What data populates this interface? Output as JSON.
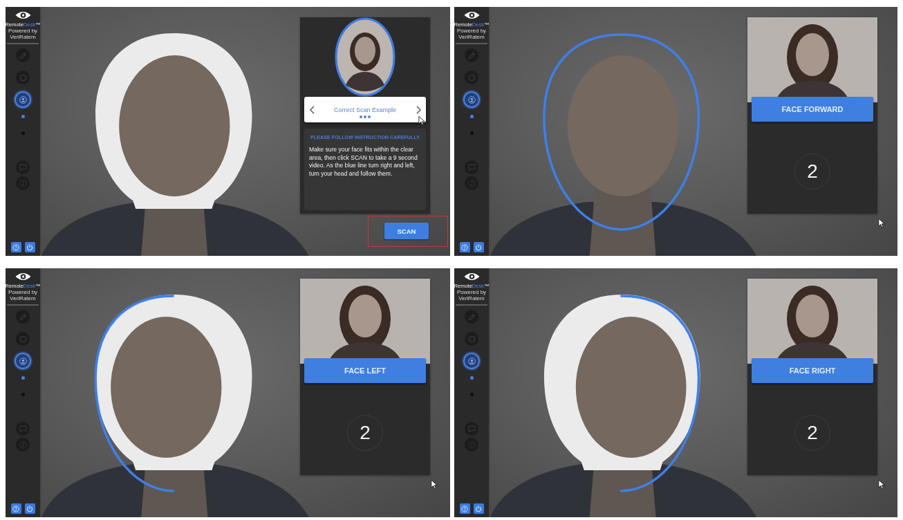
{
  "panels": [
    {
      "sidebar": {
        "logo": {
          "parts": [
            {
              "text": "Remote",
              "accent": false
            },
            {
              "text": "Desk",
              "accent": true
            },
            {
              "text": "™",
              "accent": false
            }
          ],
          "tagline": "Powered by VeriRatem"
        },
        "nav": [
          {
            "kind": "pencil",
            "selected": false
          },
          {
            "kind": "ring",
            "selected": false
          },
          {
            "kind": "user",
            "selected": true
          }
        ],
        "steps": [
          {
            "selected": true
          },
          {
            "selected": false
          }
        ],
        "tools": [
          {
            "kind": "chat"
          },
          {
            "kind": "info"
          }
        ],
        "footer_buttons": [
          {
            "kind": "help"
          },
          {
            "kind": "power"
          }
        ]
      },
      "camera": {
        "clear_area": true,
        "outline_left": false,
        "outline_right": false
      },
      "card": {
        "kind": "instructions",
        "carousel": {
          "title": "Correct Scan Example"
        },
        "heading": "PLEASE FOLLOW INSTRUCTION CAREFULLY",
        "text": "Make sure your face fits within the clear area, then click SCAN to take a 9 second video. As the blue line turn right and left, turn your head and follow them.",
        "button": {
          "label": "SCAN",
          "highlighted": true
        },
        "cursor": true
      }
    },
    {
      "sidebar": {
        "logo": {
          "parts": [
            {
              "text": "Remote",
              "accent": false
            },
            {
              "text": "Desk",
              "accent": true
            },
            {
              "text": "™",
              "accent": false
            }
          ],
          "tagline": "Powered by VeriRatem"
        },
        "nav": [
          {
            "kind": "pencil",
            "selected": false
          },
          {
            "kind": "ring",
            "selected": false
          },
          {
            "kind": "user",
            "selected": true
          }
        ],
        "steps": [
          {
            "selected": true
          },
          {
            "selected": false
          }
        ],
        "tools": [
          {
            "kind": "chat"
          },
          {
            "kind": "info"
          }
        ],
        "footer_buttons": [
          {
            "kind": "help"
          },
          {
            "kind": "power"
          }
        ]
      },
      "camera": {
        "clear_area": false,
        "outline_left": true,
        "outline_right": true
      },
      "card": {
        "kind": "countdown",
        "instruction": "FACE FORWARD",
        "count": "2",
        "cursor": true
      }
    },
    {
      "sidebar": {
        "logo": {
          "parts": [
            {
              "text": "Remote",
              "accent": false
            },
            {
              "text": "Desk",
              "accent": true
            },
            {
              "text": "™",
              "accent": false
            }
          ],
          "tagline": "Powered by VeriRatem"
        },
        "nav": [
          {
            "kind": "pencil",
            "selected": false
          },
          {
            "kind": "ring",
            "selected": false
          },
          {
            "kind": "user",
            "selected": true
          }
        ],
        "steps": [
          {
            "selected": true
          },
          {
            "selected": false
          }
        ],
        "tools": [
          {
            "kind": "chat"
          },
          {
            "kind": "info"
          }
        ],
        "footer_buttons": [
          {
            "kind": "help"
          },
          {
            "kind": "power"
          }
        ]
      },
      "camera": {
        "clear_area": true,
        "outline_left": true,
        "outline_right": false
      },
      "card": {
        "kind": "countdown",
        "instruction": "FACE LEFT",
        "count": "2",
        "cursor": true
      }
    },
    {
      "sidebar": {
        "logo": {
          "parts": [
            {
              "text": "Remote",
              "accent": false
            },
            {
              "text": "Desk",
              "accent": true
            },
            {
              "text": "™",
              "accent": false
            }
          ],
          "tagline": "Powered by VeriRatem"
        },
        "nav": [
          {
            "kind": "pencil",
            "selected": false
          },
          {
            "kind": "ring",
            "selected": false
          },
          {
            "kind": "user",
            "selected": true
          }
        ],
        "steps": [
          {
            "selected": true
          },
          {
            "selected": false
          }
        ],
        "tools": [
          {
            "kind": "chat"
          },
          {
            "kind": "info"
          }
        ],
        "footer_buttons": [
          {
            "kind": "help"
          },
          {
            "kind": "power"
          }
        ]
      },
      "camera": {
        "clear_area": true,
        "outline_left": false,
        "outline_right": true
      },
      "card": {
        "kind": "countdown",
        "instruction": "FACE RIGHT",
        "count": "2",
        "cursor": true
      }
    }
  ]
}
